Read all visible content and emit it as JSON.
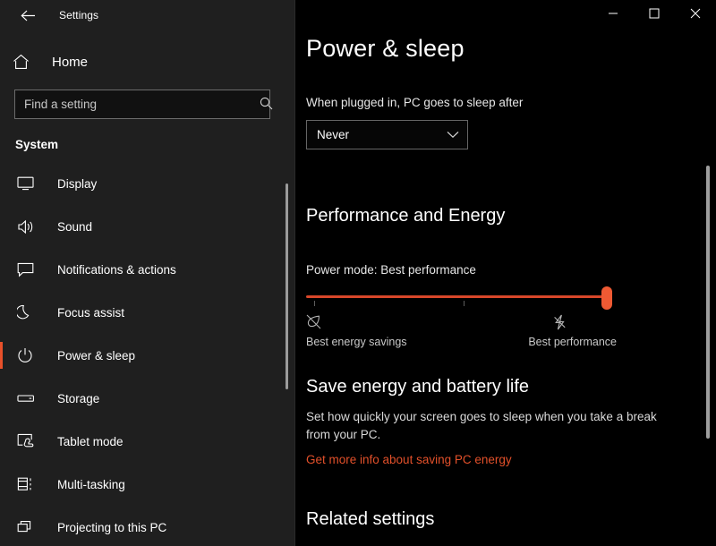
{
  "window": {
    "title": "Settings",
    "back_label": "back-arrow",
    "controls": {
      "minimize": "minimize",
      "maximize": "maximize",
      "close": "close"
    }
  },
  "sidebar": {
    "home_label": "Home",
    "search": {
      "placeholder": "Find a setting",
      "value": ""
    },
    "section_title": "System",
    "items": [
      {
        "label": "Display",
        "icon": "monitor-icon",
        "selected": false
      },
      {
        "label": "Sound",
        "icon": "speaker-icon",
        "selected": false
      },
      {
        "label": "Notifications & actions",
        "icon": "chat-bubble-icon",
        "selected": false
      },
      {
        "label": "Focus assist",
        "icon": "moon-icon",
        "selected": false
      },
      {
        "label": "Power & sleep",
        "icon": "power-icon",
        "selected": true
      },
      {
        "label": "Storage",
        "icon": "drive-icon",
        "selected": false
      },
      {
        "label": "Tablet mode",
        "icon": "tablet-touch-icon",
        "selected": false
      },
      {
        "label": "Multi-tasking",
        "icon": "multitasking-icon",
        "selected": false
      },
      {
        "label": "Projecting to this PC",
        "icon": "projecting-icon",
        "selected": false
      }
    ]
  },
  "main": {
    "page_title": "Power & sleep",
    "sleep": {
      "label": "When plugged in, PC goes to sleep after",
      "value": "Never"
    },
    "performance": {
      "heading": "Performance and Energy",
      "power_mode_label": "Power mode: Best performance",
      "slider": {
        "min_label": "Best energy savings",
        "max_label": "Best performance",
        "min_icon": "leaf-icon",
        "max_icon": "lightning-bolt-icon",
        "position_percent": 100,
        "tick_percent": [
          2,
          50
        ]
      }
    },
    "save_energy": {
      "heading": "Save energy and battery life",
      "body": "Set how quickly your screen goes to sleep when you take a break from your PC.",
      "link": "Get more info about saving PC energy"
    },
    "related": {
      "heading": "Related settings"
    }
  },
  "colors": {
    "accent": "#e8502a",
    "slider_track": "#d8472a",
    "slider_thumb": "#ef5a33",
    "link": "#e2502a",
    "sidebar_bg": "#1f1f1f",
    "main_bg": "#000000"
  }
}
